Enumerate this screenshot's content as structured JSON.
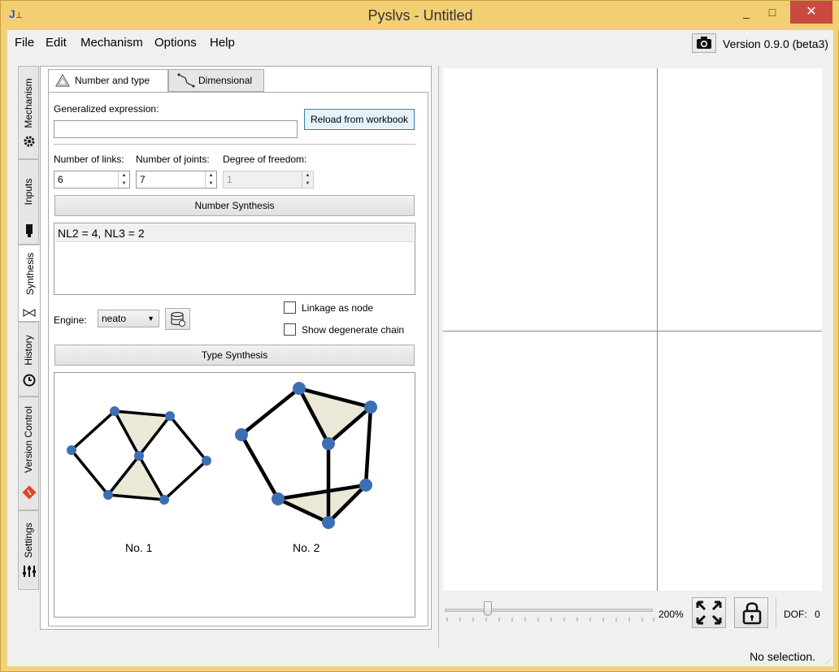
{
  "window": {
    "title": "Pyslvs - Untitled",
    "minimize": "_",
    "maximize": "□",
    "close": "✕"
  },
  "menubar": {
    "items": [
      "File",
      "Edit",
      "Mechanism",
      "Options",
      "Help"
    ],
    "version": "Version 0.9.0 (beta3)"
  },
  "side_tabs": [
    {
      "label": "Mechanism",
      "icon": "gear-icon"
    },
    {
      "label": "Inputs",
      "icon": "input-icon"
    },
    {
      "label": "Synthesis",
      "icon": "synthesis-icon",
      "active": true
    },
    {
      "label": "History",
      "icon": "history-icon"
    },
    {
      "label": "Version Control",
      "icon": "git-icon"
    },
    {
      "label": "Settings",
      "icon": "sliders-icon"
    }
  ],
  "panel_tabs": [
    {
      "label": "Number and type",
      "active": true
    },
    {
      "label": "Dimensional"
    }
  ],
  "synthesis": {
    "generalized_label": "Generalized expression:",
    "generalized_value": "",
    "reload_button": "Reload from workbook",
    "links_label": "Number of links:",
    "links_value": "6",
    "joints_label": "Number of joints:",
    "joints_value": "7",
    "dof_label": "Degree of freedom:",
    "dof_value": "1",
    "number_synthesis_button": "Number Synthesis",
    "results": [
      "NL2 = 4, NL3 = 2"
    ],
    "engine_label": "Engine:",
    "engine_value": "neato",
    "linkage_as_node": "Linkage as node",
    "show_degenerate": "Show degenerate chain",
    "type_synthesis_button": "Type Synthesis",
    "graphs": [
      {
        "caption": "No. 1"
      },
      {
        "caption": "No. 2"
      }
    ]
  },
  "canvas": {
    "zoom": "200%",
    "zoom_fraction": 0.2,
    "dof_label": "DOF:",
    "dof_value": "0"
  },
  "status": "No selection.",
  "colors": {
    "title_bar": "#f3cf74",
    "node": "#3c6eb4",
    "triangle_fill": "#ece8d8",
    "close": "#c94a3e"
  }
}
